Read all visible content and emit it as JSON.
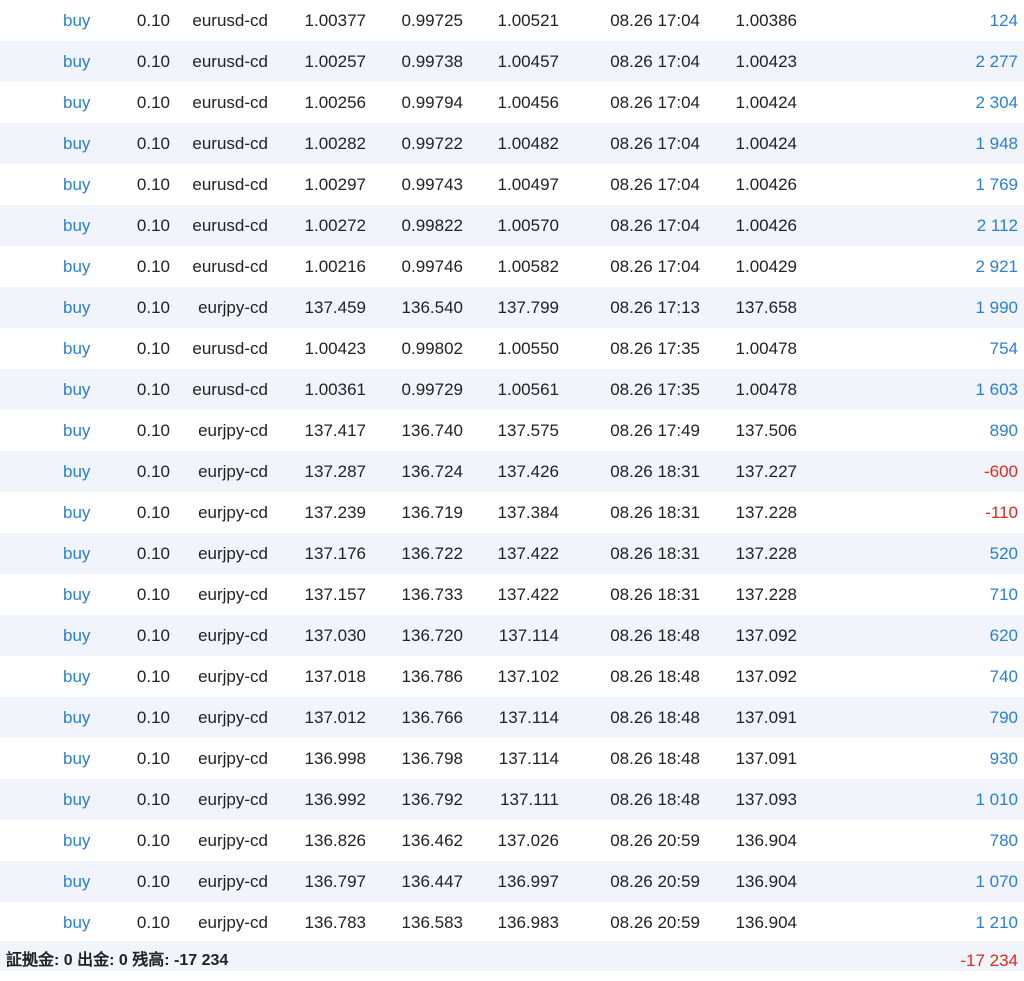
{
  "colors": {
    "link_blue": "#2a7fd4",
    "loss_red": "#e0291b",
    "row_alt_bg": "#f1f4fb",
    "text": "#222222"
  },
  "orders": [
    {
      "type": "buy",
      "volume": "0.10",
      "symbol": "eurusd-cd",
      "open_price": "1.00377",
      "sl": "0.99725",
      "tp": "1.00521",
      "time": "08.26 17:04",
      "price": "1.00386",
      "profit": "124",
      "profit_sign": "pos"
    },
    {
      "type": "buy",
      "volume": "0.10",
      "symbol": "eurusd-cd",
      "open_price": "1.00257",
      "sl": "0.99738",
      "tp": "1.00457",
      "time": "08.26 17:04",
      "price": "1.00423",
      "profit": "2 277",
      "profit_sign": "pos"
    },
    {
      "type": "buy",
      "volume": "0.10",
      "symbol": "eurusd-cd",
      "open_price": "1.00256",
      "sl": "0.99794",
      "tp": "1.00456",
      "time": "08.26 17:04",
      "price": "1.00424",
      "profit": "2 304",
      "profit_sign": "pos"
    },
    {
      "type": "buy",
      "volume": "0.10",
      "symbol": "eurusd-cd",
      "open_price": "1.00282",
      "sl": "0.99722",
      "tp": "1.00482",
      "time": "08.26 17:04",
      "price": "1.00424",
      "profit": "1 948",
      "profit_sign": "pos"
    },
    {
      "type": "buy",
      "volume": "0.10",
      "symbol": "eurusd-cd",
      "open_price": "1.00297",
      "sl": "0.99743",
      "tp": "1.00497",
      "time": "08.26 17:04",
      "price": "1.00426",
      "profit": "1 769",
      "profit_sign": "pos"
    },
    {
      "type": "buy",
      "volume": "0.10",
      "symbol": "eurusd-cd",
      "open_price": "1.00272",
      "sl": "0.99822",
      "tp": "1.00570",
      "time": "08.26 17:04",
      "price": "1.00426",
      "profit": "2 112",
      "profit_sign": "pos"
    },
    {
      "type": "buy",
      "volume": "0.10",
      "symbol": "eurusd-cd",
      "open_price": "1.00216",
      "sl": "0.99746",
      "tp": "1.00582",
      "time": "08.26 17:04",
      "price": "1.00429",
      "profit": "2 921",
      "profit_sign": "pos"
    },
    {
      "type": "buy",
      "volume": "0.10",
      "symbol": "eurjpy-cd",
      "open_price": "137.459",
      "sl": "136.540",
      "tp": "137.799",
      "time": "08.26 17:13",
      "price": "137.658",
      "profit": "1 990",
      "profit_sign": "pos"
    },
    {
      "type": "buy",
      "volume": "0.10",
      "symbol": "eurusd-cd",
      "open_price": "1.00423",
      "sl": "0.99802",
      "tp": "1.00550",
      "time": "08.26 17:35",
      "price": "1.00478",
      "profit": "754",
      "profit_sign": "pos"
    },
    {
      "type": "buy",
      "volume": "0.10",
      "symbol": "eurusd-cd",
      "open_price": "1.00361",
      "sl": "0.99729",
      "tp": "1.00561",
      "time": "08.26 17:35",
      "price": "1.00478",
      "profit": "1 603",
      "profit_sign": "pos"
    },
    {
      "type": "buy",
      "volume": "0.10",
      "symbol": "eurjpy-cd",
      "open_price": "137.417",
      "sl": "136.740",
      "tp": "137.575",
      "time": "08.26 17:49",
      "price": "137.506",
      "profit": "890",
      "profit_sign": "pos"
    },
    {
      "type": "buy",
      "volume": "0.10",
      "symbol": "eurjpy-cd",
      "open_price": "137.287",
      "sl": "136.724",
      "tp": "137.426",
      "time": "08.26 18:31",
      "price": "137.227",
      "profit": "-600",
      "profit_sign": "neg"
    },
    {
      "type": "buy",
      "volume": "0.10",
      "symbol": "eurjpy-cd",
      "open_price": "137.239",
      "sl": "136.719",
      "tp": "137.384",
      "time": "08.26 18:31",
      "price": "137.228",
      "profit": "-110",
      "profit_sign": "neg"
    },
    {
      "type": "buy",
      "volume": "0.10",
      "symbol": "eurjpy-cd",
      "open_price": "137.176",
      "sl": "136.722",
      "tp": "137.422",
      "time": "08.26 18:31",
      "price": "137.228",
      "profit": "520",
      "profit_sign": "pos"
    },
    {
      "type": "buy",
      "volume": "0.10",
      "symbol": "eurjpy-cd",
      "open_price": "137.157",
      "sl": "136.733",
      "tp": "137.422",
      "time": "08.26 18:31",
      "price": "137.228",
      "profit": "710",
      "profit_sign": "pos"
    },
    {
      "type": "buy",
      "volume": "0.10",
      "symbol": "eurjpy-cd",
      "open_price": "137.030",
      "sl": "136.720",
      "tp": "137.114",
      "time": "08.26 18:48",
      "price": "137.092",
      "profit": "620",
      "profit_sign": "pos"
    },
    {
      "type": "buy",
      "volume": "0.10",
      "symbol": "eurjpy-cd",
      "open_price": "137.018",
      "sl": "136.786",
      "tp": "137.102",
      "time": "08.26 18:48",
      "price": "137.092",
      "profit": "740",
      "profit_sign": "pos"
    },
    {
      "type": "buy",
      "volume": "0.10",
      "symbol": "eurjpy-cd",
      "open_price": "137.012",
      "sl": "136.766",
      "tp": "137.114",
      "time": "08.26 18:48",
      "price": "137.091",
      "profit": "790",
      "profit_sign": "pos"
    },
    {
      "type": "buy",
      "volume": "0.10",
      "symbol": "eurjpy-cd",
      "open_price": "136.998",
      "sl": "136.798",
      "tp": "137.114",
      "time": "08.26 18:48",
      "price": "137.091",
      "profit": "930",
      "profit_sign": "pos"
    },
    {
      "type": "buy",
      "volume": "0.10",
      "symbol": "eurjpy-cd",
      "open_price": "136.992",
      "sl": "136.792",
      "tp": "137.111",
      "time": "08.26 18:48",
      "price": "137.093",
      "profit": "1 010",
      "profit_sign": "pos"
    },
    {
      "type": "buy",
      "volume": "0.10",
      "symbol": "eurjpy-cd",
      "open_price": "136.826",
      "sl": "136.462",
      "tp": "137.026",
      "time": "08.26 20:59",
      "price": "136.904",
      "profit": "780",
      "profit_sign": "pos"
    },
    {
      "type": "buy",
      "volume": "0.10",
      "symbol": "eurjpy-cd",
      "open_price": "136.797",
      "sl": "136.447",
      "tp": "136.997",
      "time": "08.26 20:59",
      "price": "136.904",
      "profit": "1 070",
      "profit_sign": "pos"
    },
    {
      "type": "buy",
      "volume": "0.10",
      "symbol": "eurjpy-cd",
      "open_price": "136.783",
      "sl": "136.583",
      "tp": "136.983",
      "time": "08.26 20:59",
      "price": "136.904",
      "profit": "1 210",
      "profit_sign": "pos"
    }
  ],
  "summary": {
    "text": "証拠金: 0 出金: 0 残高: -17 234",
    "total_profit": "-17 234",
    "total_sign": "neg"
  }
}
